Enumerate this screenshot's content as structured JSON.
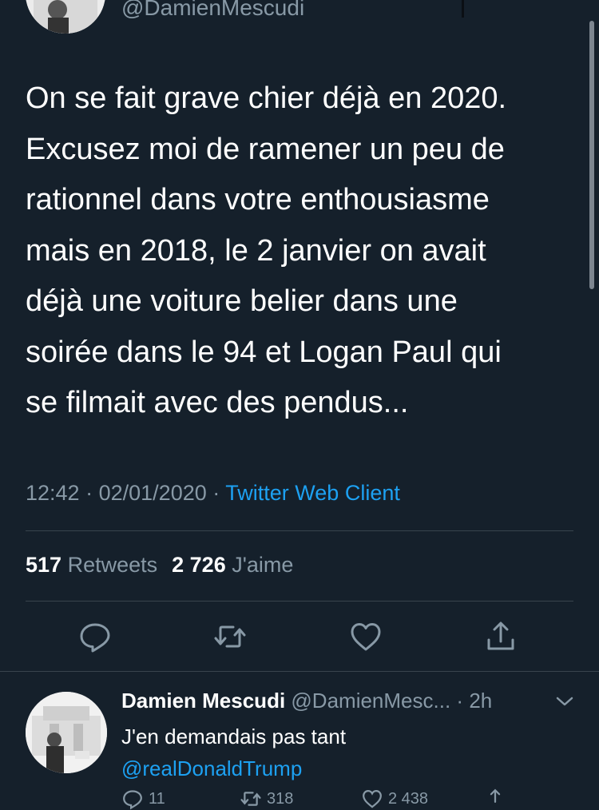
{
  "colors": {
    "background": "#15202b",
    "text_primary": "#ffffff",
    "text_secondary": "#8899a6",
    "accent": "#1da1f2",
    "divider": "#38444d"
  },
  "tweet": {
    "handle": "@DamienMescudi",
    "text_lines": [
      "On se fait grave chier déjà en 2020.",
      "Excusez moi de ramener un peu de",
      "rationnel dans votre enthousiasme",
      "mais en 2018, le 2 janvier on avait",
      "déjà une voiture belier dans une",
      "soirée dans le 94 et Logan Paul qui",
      "se filmait avec des pendus..."
    ],
    "time": "12:42",
    "date": "02/01/2020",
    "separator": "·",
    "client": "Twitter Web Client",
    "retweets_count": "517",
    "retweets_label": "Retweets",
    "likes_count": "2 726",
    "likes_label": "J'aime",
    "actions": {
      "reply_icon": "reply-icon",
      "retweet_icon": "retweet-icon",
      "like_icon": "heart-icon",
      "share_icon": "share-icon"
    }
  },
  "reply": {
    "name": "Damien Mescudi",
    "handle": "@DamienMesc...",
    "separator": "·",
    "time": "2h",
    "text": "J'en demandais pas tant",
    "mention": "@realDonaldTrump",
    "reply_count": "11",
    "retweet_count": "318",
    "like_count": "2 438"
  }
}
